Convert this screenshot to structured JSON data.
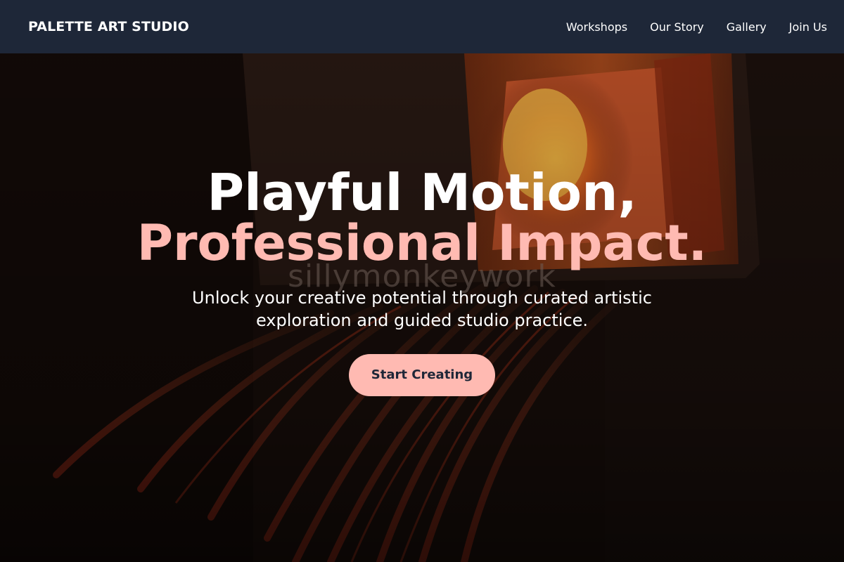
{
  "navbar": {
    "brand": "PALETTE ART STUDIO",
    "links": [
      "Workshops",
      "Our Story",
      "Gallery",
      "Join Us"
    ]
  },
  "hero": {
    "headline_line1": "Playful Motion,",
    "headline_line2": "Professional Impact.",
    "subtitle": "Unlock your creative potential through curated artistic exploration and guided studio practice.",
    "cta_label": "Start Creating",
    "watermark": "sillymonkeywork"
  },
  "colors": {
    "nav_background": "#1e2738",
    "accent_pink": "#ffbab2",
    "button_text": "#1e2738"
  }
}
